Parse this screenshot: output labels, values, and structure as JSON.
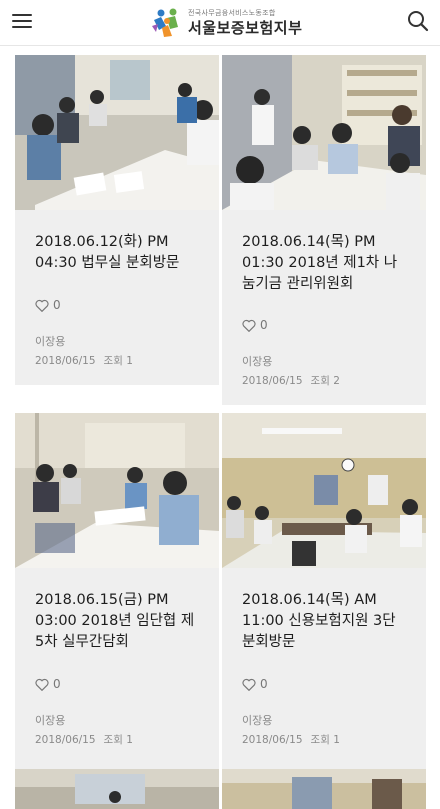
{
  "header": {
    "logo_sub": "전국사무금융서비스노동조합",
    "logo_main": "서울보증보험지부",
    "menu_icon": "hamburger-icon",
    "search_icon": "search-icon"
  },
  "posts": [
    {
      "title": "2018.06.12(화) PM 04:30 법무실 분회방문",
      "likes": "0",
      "author": "이장용",
      "date": "2018/06/15",
      "views": "조회 1"
    },
    {
      "title": "2018.06.14(목) PM 01:30 2018년 제1차 나눔기금 관리위원회",
      "likes": "0",
      "author": "이장용",
      "date": "2018/06/15",
      "views": "조회 2"
    },
    {
      "title": "2018.06.15(금) PM 03:00 2018년 임단협 제5차 실무간담회",
      "likes": "0",
      "author": "이장용",
      "date": "2018/06/15",
      "views": "조회 1"
    },
    {
      "title": "2018.06.14(목) AM 11:00 신용보험지원 3단 분회방문",
      "likes": "0",
      "author": "이장용",
      "date": "2018/06/15",
      "views": "조회 1"
    }
  ],
  "colors": {
    "card_bg": "#efefef",
    "logo_blue": "#2e7bc4",
    "logo_green": "#6ab04c",
    "logo_orange": "#f0932b"
  }
}
